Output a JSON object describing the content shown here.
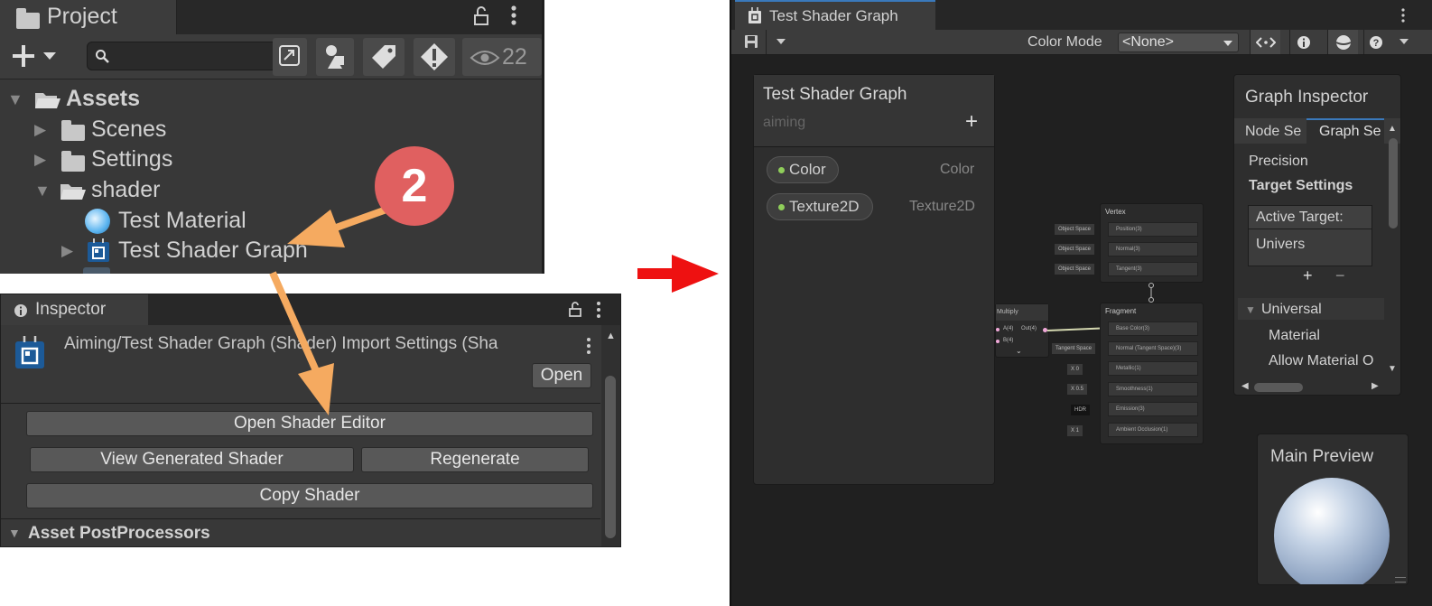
{
  "project": {
    "tab_title": "Project",
    "search_placeholder": "",
    "hidden_count": "22",
    "tree": [
      {
        "label": "Assets"
      },
      {
        "label": "Scenes"
      },
      {
        "label": "Settings"
      },
      {
        "label": "shader"
      },
      {
        "label": "Test Material"
      },
      {
        "label": "Test Shader Graph"
      }
    ]
  },
  "step_badge": {
    "number": "2",
    "color": "#e06060"
  },
  "arrow_color": "#f5aa60",
  "transition_arrow_color": "#ee1111",
  "inspector": {
    "tab_title": "Inspector",
    "header": "Aiming/Test Shader Graph (Shader) Import Settings (Sha",
    "open_label": "Open",
    "open_shader_editor": "Open Shader Editor",
    "view_generated_shader": "View Generated Shader",
    "regenerate": "Regenerate",
    "copy_shader": "Copy Shader",
    "section": "Asset PostProcessors"
  },
  "shader_graph": {
    "tab_title": "Test Shader Graph",
    "color_mode_label": "Color Mode",
    "color_mode_value": "<None>",
    "blackboard": {
      "title": "Test Shader Graph",
      "subtitle": "aiming",
      "add": "+",
      "properties": [
        {
          "name": "Color",
          "type": "Color"
        },
        {
          "name": "Texture2D",
          "type": "Texture2D"
        }
      ]
    },
    "multiply_node": {
      "title": "Multiply",
      "in_a": "A(4)",
      "in_b": "B(4)",
      "out": "Out(4)"
    },
    "vertex_block": {
      "title": "Vertex",
      "ports": [
        {
          "side": "Object Space",
          "label": "Position(3)"
        },
        {
          "side": "Object Space",
          "label": "Normal(3)"
        },
        {
          "side": "Object Space",
          "label": "Tangent(3)"
        }
      ]
    },
    "fragment_block": {
      "title": "Fragment",
      "ports": [
        {
          "side": "",
          "label": "Base Color(3)"
        },
        {
          "side": "Tangent Space",
          "label": "Normal (Tangent Space)(3)"
        },
        {
          "side": "X  0",
          "label": "Metallic(1)"
        },
        {
          "side": "X  0.5",
          "label": "Smoothness(1)"
        },
        {
          "side": "HDR",
          "label": "Emission(3)"
        },
        {
          "side": "X  1",
          "label": "Ambient Occlusion(1)"
        }
      ]
    },
    "graph_inspector": {
      "title": "Graph Inspector",
      "tab_node": "Node Se",
      "tab_graph": "Graph Se",
      "precision": "Precision",
      "target_settings": "Target Settings",
      "active_targets": "Active Target:",
      "target_item": "Univers",
      "universal": "Universal",
      "material": "Material",
      "allow_override": "Allow Material O"
    },
    "main_preview": {
      "title": "Main Preview"
    }
  }
}
